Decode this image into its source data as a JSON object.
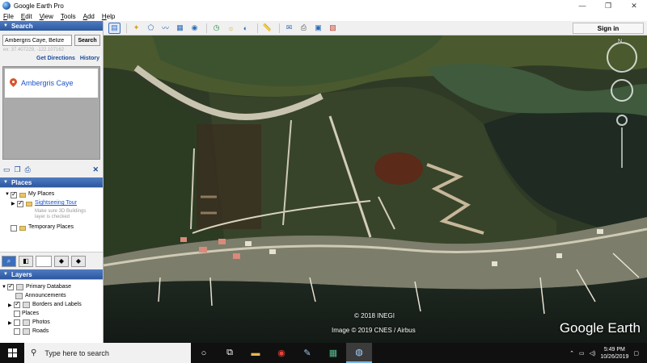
{
  "window": {
    "title": "Google Earth Pro",
    "controls": [
      "—",
      "❐",
      "✕"
    ]
  },
  "menu": [
    "File",
    "Edit",
    "View",
    "Tools",
    "Add",
    "Help"
  ],
  "toolbar": {
    "signin_label": "Sign in"
  },
  "search": {
    "header": "Search",
    "query": "Ambergris Caye, Belize",
    "button_label": "Search",
    "coords_hint": "ex: 37.407229, -122.107162",
    "get_directions": "Get Directions",
    "history": "History",
    "result": "Ambergris Caye"
  },
  "places": {
    "header": "Places",
    "my_places": "My Places",
    "sightseeing": "Sightseeing Tour",
    "note_line1": "Make sure 3D Buildings",
    "note_line2": "layer is checked",
    "temporary": "Temporary Places"
  },
  "layers": {
    "header": "Layers",
    "items": [
      "Primary Database",
      "Announcements",
      "Borders and Labels",
      "Places",
      "Photos",
      "Roads"
    ]
  },
  "map": {
    "copyright1": "© 2018 INEGI",
    "copyright2": "Image © 2019 CNES / Airbus",
    "logo": "Google Earth",
    "compass_n": "N"
  },
  "taskbar": {
    "search_placeholder": "Type here to search",
    "time": "5:49 PM",
    "date": "10/26/2019"
  }
}
